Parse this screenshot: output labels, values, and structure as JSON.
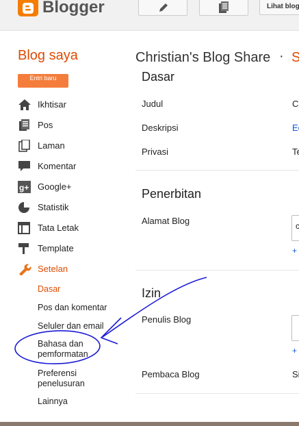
{
  "app": {
    "brand": "Blogger",
    "view_blog_label": "Lihat blog"
  },
  "header": {
    "my_blogs_label": "Blog saya",
    "blog_name": "Christian's Blog Share",
    "separator": "·",
    "next_crumb": "S"
  },
  "sidebar": {
    "new_post_label": "Entri baru",
    "items": [
      {
        "label": "Ikhtisar",
        "icon": "home-icon"
      },
      {
        "label": "Pos",
        "icon": "posts-icon"
      },
      {
        "label": "Laman",
        "icon": "pages-icon"
      },
      {
        "label": "Komentar",
        "icon": "comments-icon"
      },
      {
        "label": "Google+",
        "icon": "google-plus-icon"
      },
      {
        "label": "Statistik",
        "icon": "stats-icon"
      },
      {
        "label": "Tata Letak",
        "icon": "layout-icon"
      },
      {
        "label": "Template",
        "icon": "template-icon"
      },
      {
        "label": "Setelan",
        "icon": "wrench-icon"
      }
    ],
    "sub_items": [
      "Dasar",
      "Pos dan komentar",
      "Seluler dan email",
      "Bahasa dan pemformatan",
      "Preferensi penelusuran",
      "Lainnya"
    ]
  },
  "main": {
    "basic": {
      "title": "Dasar",
      "rows": [
        {
          "label": "Judul",
          "value": "C"
        },
        {
          "label": "Deskripsi",
          "value": "Ec"
        },
        {
          "label": "Privasi",
          "value": "Te"
        }
      ]
    },
    "publishing": {
      "title": "Penerbitan",
      "address_label": "Alamat Blog",
      "address_value": "c",
      "add_link": "+"
    },
    "permissions": {
      "title": "Izin",
      "authors_label": "Penulis Blog",
      "add_link": "+",
      "readers_label": "Pembaca Blog",
      "readers_value": "Si"
    }
  },
  "colors": {
    "accent": "#dd4b00",
    "brand": "#f57d00",
    "link": "#1155cc",
    "annotation": "#1a1ad6"
  }
}
